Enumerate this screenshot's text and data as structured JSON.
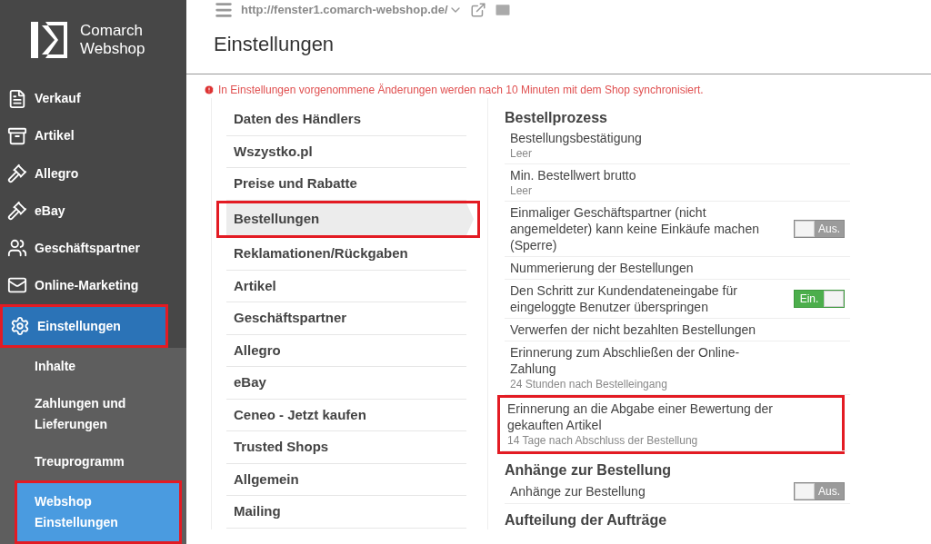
{
  "logo": {
    "line1": "Comarch",
    "line2": "Webshop"
  },
  "sidebar": {
    "items": [
      {
        "label": "Verkauf",
        "selected": false,
        "highlighted": false
      },
      {
        "label": "Artikel",
        "selected": false,
        "highlighted": false
      },
      {
        "label": "Allegro",
        "selected": false,
        "highlighted": false
      },
      {
        "label": "eBay",
        "selected": false,
        "highlighted": false
      },
      {
        "label": "Geschäftspartner",
        "selected": false,
        "highlighted": false
      },
      {
        "label": "Online-Marketing",
        "selected": false,
        "highlighted": false
      },
      {
        "label": "Einstellungen",
        "selected": true,
        "highlighted": true,
        "children": [
          {
            "label": "Inhalte",
            "selected": false,
            "highlighted": false
          },
          {
            "label": "Zahlungen und Lieferungen",
            "selected": false,
            "highlighted": false
          },
          {
            "label": "Treuprogramm",
            "selected": false,
            "highlighted": false
          },
          {
            "label": "Webshop Einstellungen",
            "selected": true,
            "highlighted": true
          }
        ]
      }
    ]
  },
  "header": {
    "url": "http://fenster1.comarch-webshop.de/",
    "title": "Einstellungen"
  },
  "alert": "In Einstellungen vorgenommene Änderungen werden nach 10 Minuten mit dem Shop synchronisiert.",
  "categories": [
    {
      "label": "Daten des Händlers",
      "selected": false,
      "highlighted": false
    },
    {
      "label": "Wszystko.pl",
      "selected": false,
      "highlighted": false
    },
    {
      "label": "Preise und Rabatte",
      "selected": false,
      "highlighted": false
    },
    {
      "label": "Bestellungen",
      "selected": true,
      "highlighted": true
    },
    {
      "label": "Reklamationen/Rückgaben",
      "selected": false,
      "highlighted": false
    },
    {
      "label": "Artikel",
      "selected": false,
      "highlighted": false
    },
    {
      "label": "Geschäftspartner",
      "selected": false,
      "highlighted": false
    },
    {
      "label": "Allegro",
      "selected": false,
      "highlighted": false
    },
    {
      "label": "eBay",
      "selected": false,
      "highlighted": false
    },
    {
      "label": "Ceneo - Jetzt kaufen",
      "selected": false,
      "highlighted": false
    },
    {
      "label": "Trusted Shops",
      "selected": false,
      "highlighted": false
    },
    {
      "label": "Allgemein",
      "selected": false,
      "highlighted": false
    },
    {
      "label": "Mailing",
      "selected": false,
      "highlighted": false
    }
  ],
  "sections": [
    {
      "title": "Bestellprozess",
      "rows": [
        {
          "label": "Bestellungsbestätigung",
          "value": "Leer",
          "highlighted": false
        },
        {
          "label": "Min. Bestellwert brutto",
          "value": "Leer",
          "highlighted": false
        },
        {
          "label": "Einmaliger Geschäftspartner (nicht angemeldeter) kann keine Einkäufe machen (Sperre)",
          "toggle": {
            "on": false,
            "label": "Aus."
          },
          "highlighted": false
        },
        {
          "label": "Nummerierung der Bestellungen",
          "highlighted": false
        },
        {
          "label": "Den Schritt zur Kundendateneingabe für eingeloggte Benutzer überspringen",
          "toggle": {
            "on": true,
            "label": "Ein."
          },
          "highlighted": false
        },
        {
          "label": "Verwerfen der nicht bezahlten Bestellungen",
          "highlighted": false
        },
        {
          "label": "Erinnerung zum Abschließen der Online-Zahlung",
          "value": "24 Stunden nach Bestelleingang",
          "highlighted": false
        },
        {
          "label": "Erinnerung an die Abgabe einer Bewertung der gekauften Artikel",
          "value": "14 Tage nach Abschluss der Bestellung",
          "highlighted": true
        }
      ]
    },
    {
      "title": "Anhänge zur Bestellung",
      "rows": [
        {
          "label": "Anhänge zur Bestellung",
          "toggle": {
            "on": false,
            "label": "Aus."
          },
          "highlighted": false
        }
      ]
    },
    {
      "title": "Aufteilung der Aufträge"
    }
  ]
}
